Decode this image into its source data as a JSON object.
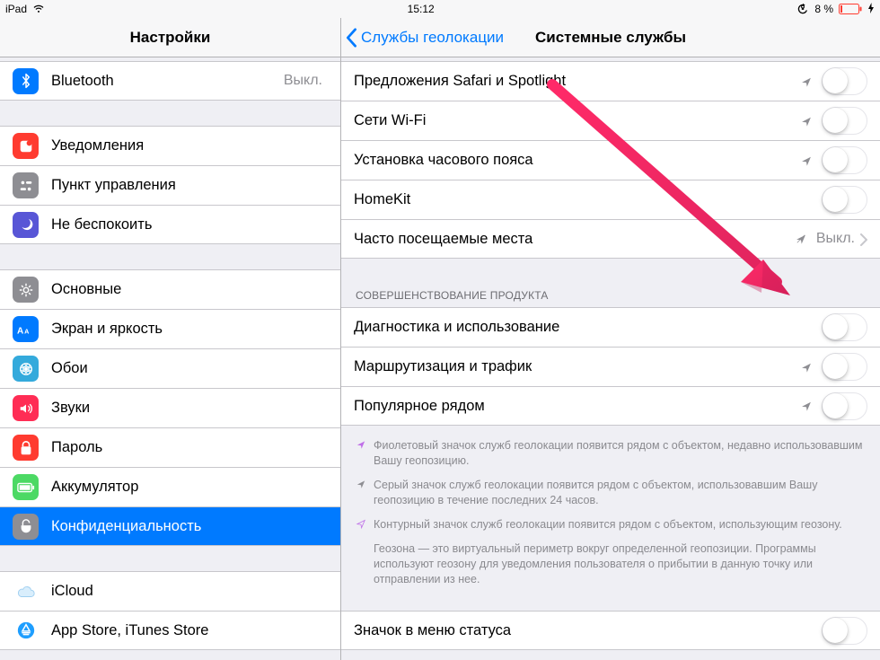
{
  "statusbar": {
    "device": "iPad",
    "time": "15:12",
    "battery_text": "8 %"
  },
  "sidebar": {
    "title": "Настройки",
    "groups": [
      [
        {
          "key": "bluetooth",
          "label": "Bluetooth",
          "value": "Выкл.",
          "icon": "bluetooth",
          "color": "#007aff"
        }
      ],
      [
        {
          "key": "notifications",
          "label": "Уведомления",
          "icon": "notifications",
          "color": "#ff3b30"
        },
        {
          "key": "control-center",
          "label": "Пункт управления",
          "icon": "control-center",
          "color": "#8e8e93"
        },
        {
          "key": "dnd",
          "label": "Не беспокоить",
          "icon": "dnd",
          "color": "#5856d6"
        }
      ],
      [
        {
          "key": "general",
          "label": "Основные",
          "icon": "general",
          "color": "#8e8e93"
        },
        {
          "key": "display",
          "label": "Экран и яркость",
          "icon": "display",
          "color": "#007aff"
        },
        {
          "key": "wallpaper",
          "label": "Обои",
          "icon": "wallpaper",
          "color": "#34aadc"
        },
        {
          "key": "sounds",
          "label": "Звуки",
          "icon": "sounds",
          "color": "#ff2d55"
        },
        {
          "key": "passcode",
          "label": "Пароль",
          "icon": "passcode",
          "color": "#ff3b30"
        },
        {
          "key": "battery",
          "label": "Аккумулятор",
          "icon": "battery",
          "color": "#4cd964"
        },
        {
          "key": "privacy",
          "label": "Конфиденциальность",
          "icon": "privacy",
          "color": "#8e8e93",
          "selected": true
        }
      ],
      [
        {
          "key": "icloud",
          "label": "iCloud",
          "icon": "icloud",
          "color": "#ffffff"
        },
        {
          "key": "appstore",
          "label": "App Store, iTunes Store",
          "icon": "appstore",
          "color": "#ffffff"
        }
      ]
    ]
  },
  "detail": {
    "back_label": "Службы геолокации",
    "title": "Системные службы",
    "sections": [
      {
        "header": null,
        "rows": [
          {
            "key": "safari-spotlight",
            "label": "Предложения Safari и Spotlight",
            "arrow": "gray",
            "toggle": false
          },
          {
            "key": "wifi-networking",
            "label": "Сети Wi-Fi",
            "arrow": "gray",
            "toggle": false
          },
          {
            "key": "timezone",
            "label": "Установка часового пояса",
            "arrow": "gray",
            "toggle": false
          },
          {
            "key": "homekit",
            "label": "HomeKit",
            "arrow": null,
            "toggle": false
          },
          {
            "key": "frequent-locations",
            "label": "Часто посещаемые места",
            "value": "Выкл.",
            "disclosure": true,
            "arrow": "gray-strike"
          }
        ]
      },
      {
        "header": "СОВЕРШЕНСТВОВАНИЕ ПРОДУКТА",
        "rows": [
          {
            "key": "diagnostics",
            "label": "Диагностика и использование",
            "arrow": null,
            "toggle": false
          },
          {
            "key": "routing-traffic",
            "label": "Маршрутизация и трафик",
            "arrow": "gray",
            "toggle": false
          },
          {
            "key": "popular-nearby",
            "label": "Популярное рядом",
            "arrow": "gray",
            "toggle": false
          }
        ]
      }
    ],
    "notes": {
      "purple": "Фиолетовый значок служб геолокации появится рядом с объектом, недавно использовавшим Вашу геопозицию.",
      "gray": "Серый значок служб геолокации появится рядом с объектом, использовавшим Вашу геопозицию в течение последних 24 часов.",
      "outline": "Контурный значок служб геолокации появится рядом с объектом, использующим геозону.",
      "geofence": "Геозона — это виртуальный периметр вокруг определенной геопозиции. Программы используют геозону для уведомления пользователя о прибытии в данную точку или отправлении из нее."
    },
    "last_section_row": {
      "key": "status-bar-icon",
      "label": "Значок в меню статуса",
      "toggle": false
    }
  }
}
